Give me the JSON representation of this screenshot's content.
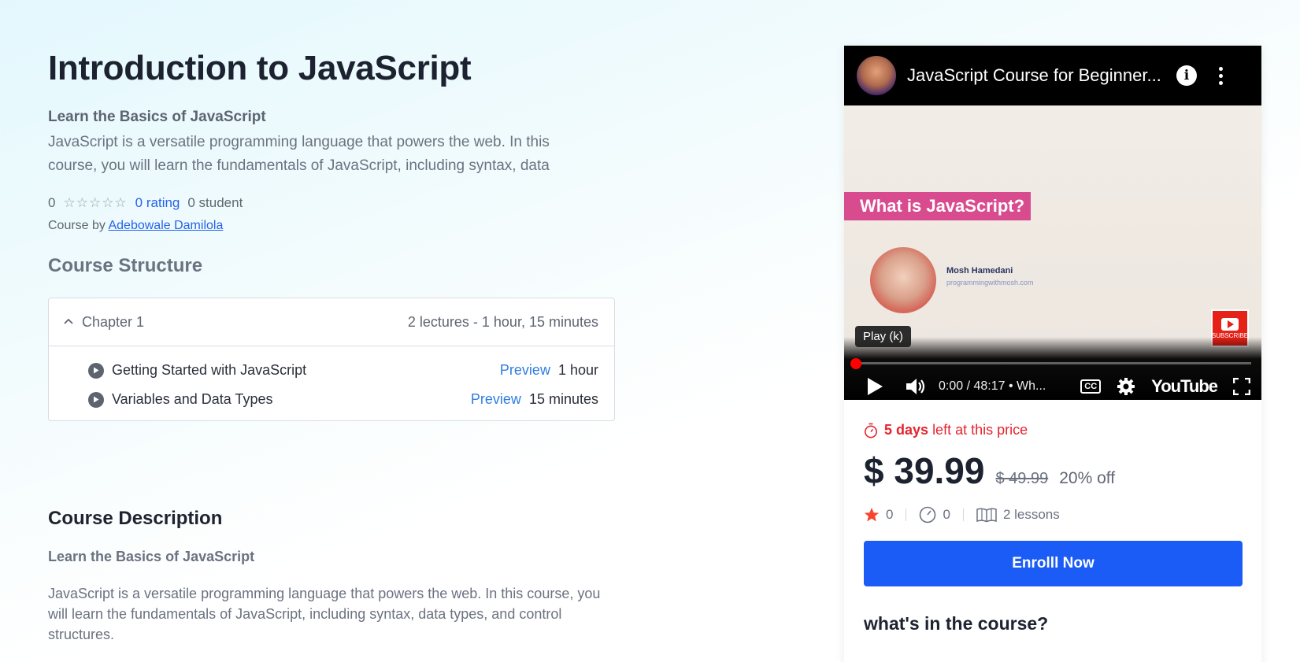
{
  "course": {
    "title": "Introduction to JavaScript",
    "subtitle": "Learn the Basics of JavaScript",
    "intro": "JavaScript is a versatile programming language that powers the web. In this course, you will learn the fundamentals of JavaScript, including syntax, data",
    "rating_value": "0",
    "stars": "☆☆☆☆☆",
    "rating_link": "0 rating",
    "students": "0 student",
    "byline_prefix": "Course by",
    "author": "Adebowale Damilola"
  },
  "structure": {
    "heading": "Course Structure",
    "chapter": {
      "name": "Chapter 1",
      "summary": "2 lectures - 1 hour, 15 minutes",
      "lectures": [
        {
          "title": "Getting Started with JavaScript",
          "preview": "Preview",
          "duration": "1 hour"
        },
        {
          "title": "Variables and Data Types",
          "preview": "Preview",
          "duration": "15 minutes"
        }
      ]
    }
  },
  "description": {
    "heading": "Course Description",
    "subtitle": "Learn the Basics of JavaScript",
    "body": "JavaScript is a versatile programming language that powers the web. In this course, you will learn the fundamentals of JavaScript, including syntax, data types, and control structures."
  },
  "video": {
    "title": "JavaScript Course for Beginner...",
    "banner": "What is JavaScript?",
    "presenter_name": "Mosh Hamedani",
    "presenter_site": "programmingwithmosh.com",
    "subscribe": "SUBSCRIBE",
    "tooltip": "Play (k)",
    "time": "0:00 / 48:17 • Wh...",
    "cc": "CC",
    "brand": "YouTube",
    "progress": 0
  },
  "pricing": {
    "days_left": "5 days",
    "days_suffix": "left at this price",
    "price": "$ 39.99",
    "old_price": "$ 49.99",
    "discount": "20% off",
    "stars_count": "0",
    "time_count": "0",
    "lessons": "2 lessons",
    "enroll_label": "Enrolll Now",
    "whats_in": "what's in the course?"
  },
  "colors": {
    "accent": "#1a5cf5",
    "link": "#2463eb",
    "alert": "#e5242e",
    "star": "#f5452e"
  }
}
